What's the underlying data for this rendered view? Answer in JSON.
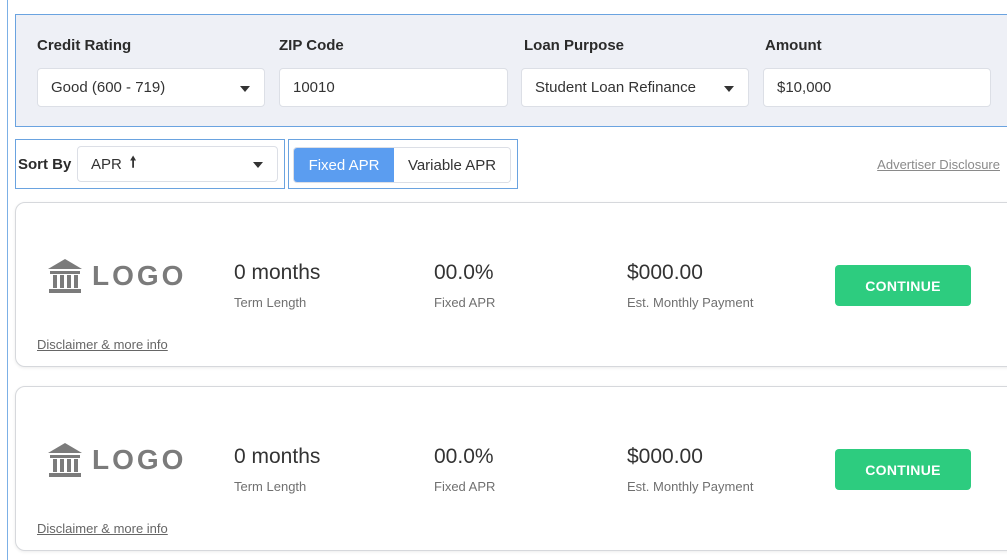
{
  "filters": {
    "credit_rating": {
      "label": "Credit Rating",
      "value": "Good (600 - 719)"
    },
    "zip_code": {
      "label": "ZIP Code",
      "value": "10010"
    },
    "loan_purpose": {
      "label": "Loan Purpose",
      "value": "Student Loan Refinance"
    },
    "amount": {
      "label": "Amount",
      "value": "$10,000"
    }
  },
  "sort": {
    "label": "Sort By",
    "value": "APR",
    "direction_icon": "up-arrow-icon",
    "direction_glyph": "🠕"
  },
  "apr_toggle": {
    "fixed_label": "Fixed APR",
    "variable_label": "Variable APR",
    "selected": "fixed"
  },
  "advertiser_disclosure": "Advertiser Disclosure",
  "offers": [
    {
      "logo_icon": "bank-icon",
      "logo_text": "LOGO",
      "term_value": "0 months",
      "term_label": "Term Length",
      "apr_value": "00.0%",
      "apr_label": "Fixed APR",
      "payment_value": "$000.00",
      "payment_label": "Est. Monthly Payment",
      "cta_label": "CONTINUE",
      "disclaimer_label": "Disclaimer & more info"
    },
    {
      "logo_icon": "bank-icon",
      "logo_text": "LOGO",
      "term_value": "0 months",
      "term_label": "Term Length",
      "apr_value": "00.0%",
      "apr_label": "Fixed APR",
      "payment_value": "$000.00",
      "payment_label": "Est. Monthly Payment",
      "cta_label": "CONTINUE",
      "disclaimer_label": "Disclaimer & more info"
    }
  ],
  "colors": {
    "accent_blue": "#5b9df0",
    "cta_green": "#2dcc7f",
    "panel_bg": "#eef0f6"
  }
}
